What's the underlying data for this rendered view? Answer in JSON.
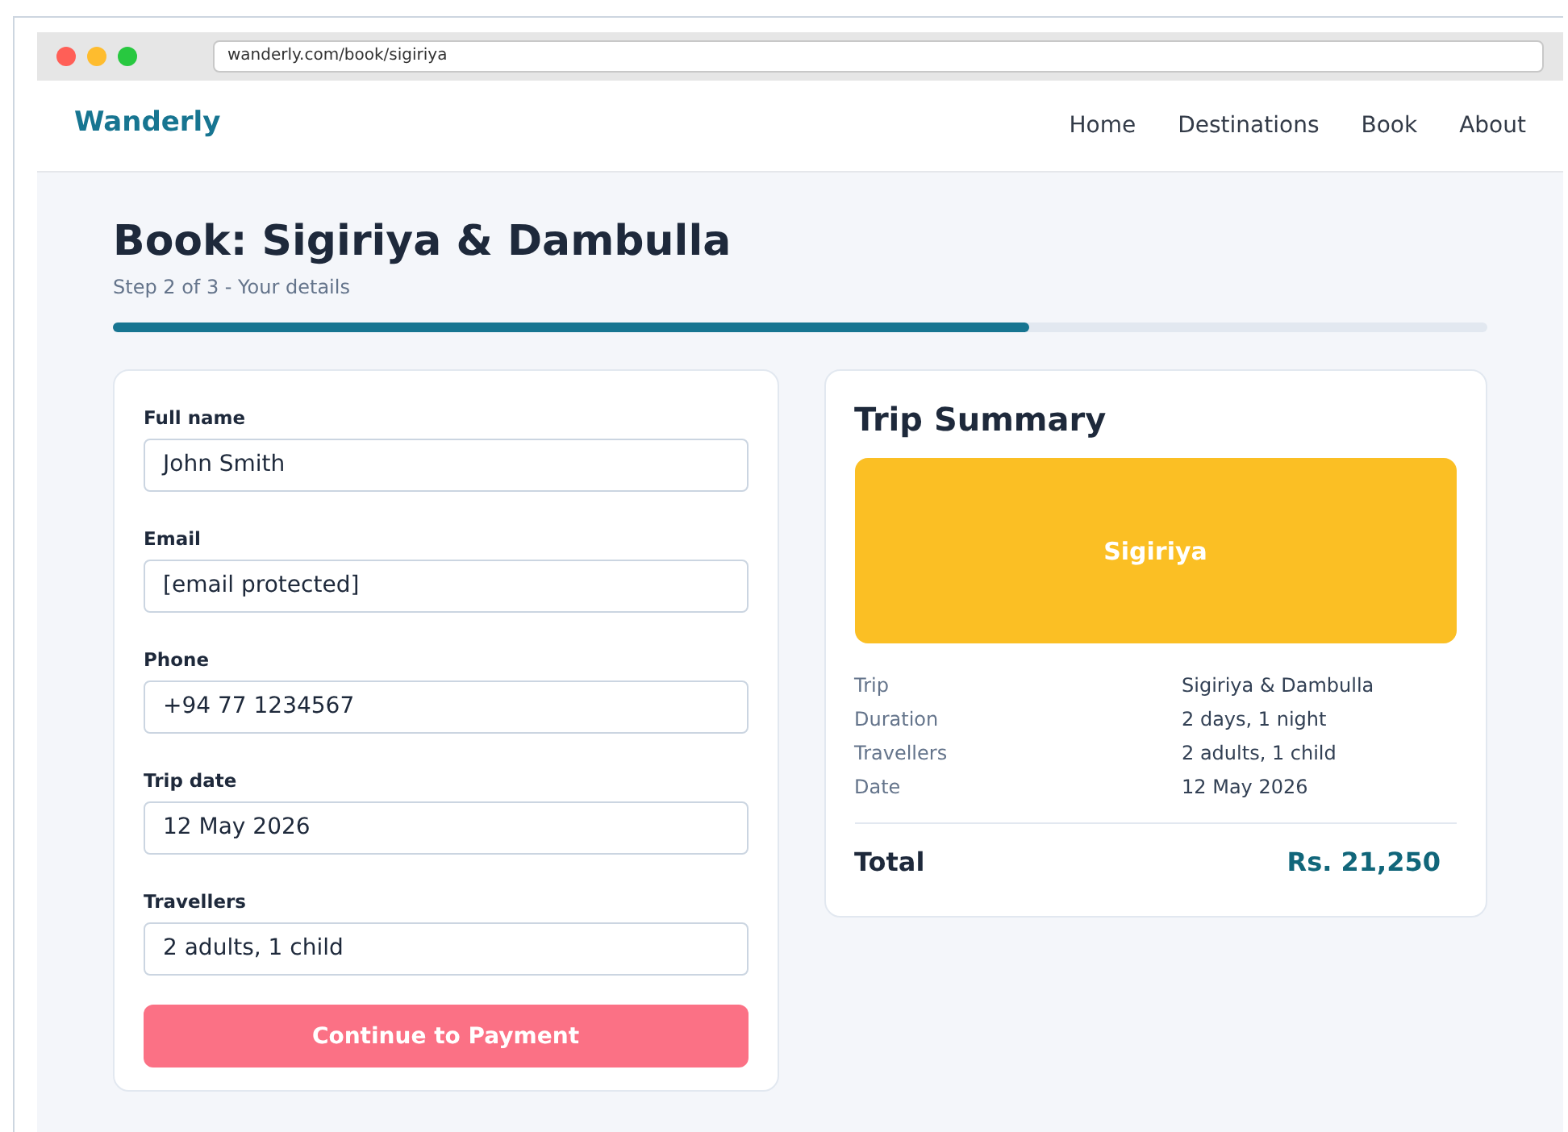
{
  "browser": {
    "url": "wanderly.com/book/sigiriya"
  },
  "nav": {
    "brand": "Wanderly",
    "links": [
      "Home",
      "Destinations",
      "Book",
      "About"
    ]
  },
  "page": {
    "title": "Book: Sigiriya & Dambulla",
    "subtitle": "Step 2 of 3 - Your details",
    "progress": {
      "level": 0.667
    }
  },
  "form": {
    "fields": [
      {
        "label": "Full name",
        "value": "John Smith"
      },
      {
        "label": "Email",
        "value": "[email protected]"
      },
      {
        "label": "Phone",
        "value": "+94 77 1234567"
      },
      {
        "label": "Trip date",
        "value": "12 May 2026"
      },
      {
        "label": "Travellers",
        "value": "2 adults, 1 child"
      }
    ],
    "submit": "Continue to Payment"
  },
  "summary": {
    "title": "Trip Summary",
    "banner": {
      "text": "Sigiriya",
      "color": "#fbbf24"
    },
    "rows": [
      {
        "label": "Trip",
        "value": "Sigiriya & Dambulla"
      },
      {
        "label": "Duration",
        "value": "2 days, 1 night"
      },
      {
        "label": "Travellers",
        "value": "2 adults, 1 child"
      },
      {
        "label": "Date",
        "value": "12 May 2026"
      }
    ],
    "total_label": "Total",
    "total_value": "Rs. 21,250"
  }
}
